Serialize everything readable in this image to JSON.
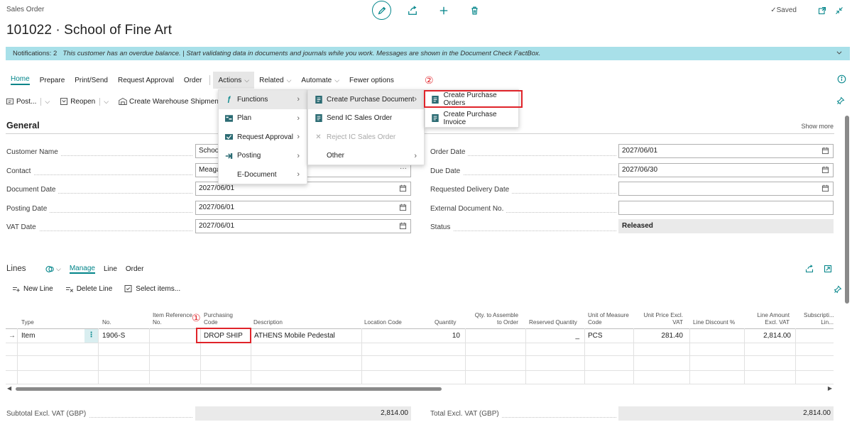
{
  "header": {
    "page_kind": "Sales Order",
    "title": "101022 · School of Fine Art",
    "saved": "Saved"
  },
  "notification": {
    "count_label": "Notifications: 2",
    "text": "This customer has an overdue balance.  |  Start validating data in documents and journals while you work. Messages are shown in the Document Check FactBox."
  },
  "action_bar": {
    "items": [
      "Home",
      "Prepare",
      "Print/Send",
      "Request Approval",
      "Order",
      "Actions",
      "Related",
      "Automate",
      "Fewer options"
    ]
  },
  "toolbar": {
    "post": "Post...",
    "reopen": "Reopen",
    "warehouse": "Create Warehouse Shipment"
  },
  "general": {
    "title": "General",
    "show_more": "Show more",
    "left_fields": [
      {
        "label": "Customer Name",
        "value": "School"
      },
      {
        "label": "Contact",
        "value": "Meaga"
      },
      {
        "label": "Document Date",
        "value": "2027/06/01"
      },
      {
        "label": "Posting Date",
        "value": "2027/06/01"
      },
      {
        "label": "VAT Date",
        "value": "2027/06/01"
      }
    ],
    "right_fields": [
      {
        "label": "Order Date",
        "value": "2027/06/01"
      },
      {
        "label": "Due Date",
        "value": "2027/06/30"
      },
      {
        "label": "Requested Delivery Date",
        "value": ""
      },
      {
        "label": "External Document No.",
        "value": ""
      },
      {
        "label": "Status",
        "value": "Released"
      }
    ]
  },
  "lines": {
    "title": "Lines",
    "tabs": [
      "Manage",
      "Line",
      "Order"
    ],
    "tools": [
      "New Line",
      "Delete Line",
      "Select items..."
    ],
    "columns": [
      "Type",
      "No.",
      "Item Reference No.",
      "Purchasing Code",
      "Description",
      "Location Code",
      "Quantity",
      "Qty. to Assemble to Order",
      "Reserved Quantity",
      "Unit of Measure Code",
      "Unit Price Excl. VAT",
      "Line Discount %",
      "Line Amount Excl. VAT",
      "Subscripti... Lin..."
    ],
    "row": {
      "type": "Item",
      "no": "1906-S",
      "purchasing_code": "DROP SHIP",
      "description": "ATHENS Mobile Pedestal",
      "quantity": "10",
      "reserved": "_",
      "uom": "PCS",
      "unit_price": "281.40",
      "line_amount": "2,814.00"
    }
  },
  "totals": {
    "subtotal_label": "Subtotal Excl. VAT (GBP)",
    "subtotal_value": "2,814.00",
    "total_label": "Total Excl. VAT (GBP)",
    "total_value": "2,814.00"
  },
  "menus": {
    "actions": [
      {
        "label": "Functions",
        "icon": "function-icon"
      },
      {
        "label": "Plan",
        "icon": "plan-icon"
      },
      {
        "label": "Request Approval",
        "icon": "approval-icon"
      },
      {
        "label": "Posting",
        "icon": "posting-icon"
      },
      {
        "label": "E-Document",
        "icon": ""
      }
    ],
    "functions": [
      {
        "label": "Create Purchase Document",
        "icon": "document-icon"
      },
      {
        "label": "Send IC Sales Order",
        "icon": "document-icon"
      },
      {
        "label": "Reject IC Sales Order",
        "icon": "x-icon"
      },
      {
        "label": "Other",
        "icon": ""
      }
    ],
    "purchase": [
      {
        "label": "Create Purchase Orders",
        "icon": "document-icon"
      },
      {
        "label": "Create Purchase Invoice",
        "icon": "document-icon"
      }
    ]
  },
  "annotations": {
    "one": "①",
    "two": "②"
  },
  "colors": {
    "accent": "#008489",
    "notification_bg": "#a8e0e9",
    "highlight_red": "#e0242a"
  }
}
